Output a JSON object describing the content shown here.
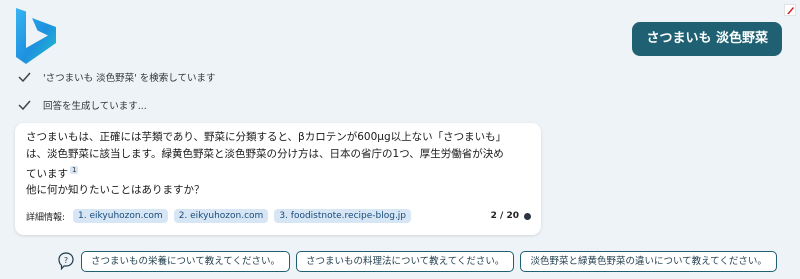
{
  "header": {
    "user_query": "さつまいも 淡色野菜"
  },
  "status": [
    {
      "text": "'さつまいも 淡色野菜' を検索しています"
    },
    {
      "text": "回答を生成しています..."
    }
  ],
  "answer": {
    "lines": [
      "さつまいもは、正確には芋類であり、野菜に分類すると、βカロテンが600μg以上ない「さつまいも」",
      "は、淡色野菜に該当します。緑黄色野菜と淡色野菜の分け方は、日本の省庁の1つ、厚生労働省が決め",
      "ています"
    ],
    "citation": "1",
    "follow_up": "他に何か知りたいことはありますか？"
  },
  "sources": {
    "label": "詳細情報:",
    "links": [
      "1. eikyuhozon.com",
      "2. eikyuhozon.com",
      "3. foodistnote.recipe-blog.jp"
    ],
    "counter": "2 / 20"
  },
  "suggestions": [
    "さつまいもの栄養について教えてください。",
    "さつまいもの料理法について教えてください。",
    "淡色野菜と緑黄色野菜の違いについて教えてください。"
  ],
  "icons": {
    "logo": "bing-logo-icon",
    "check": "checkmark-icon",
    "help": "question-help-icon",
    "badge": "red-extension-badge-icon"
  },
  "colors": {
    "accent": "#1f6172",
    "background": "#eef3f7",
    "source_chip": "#d6e6f4"
  }
}
